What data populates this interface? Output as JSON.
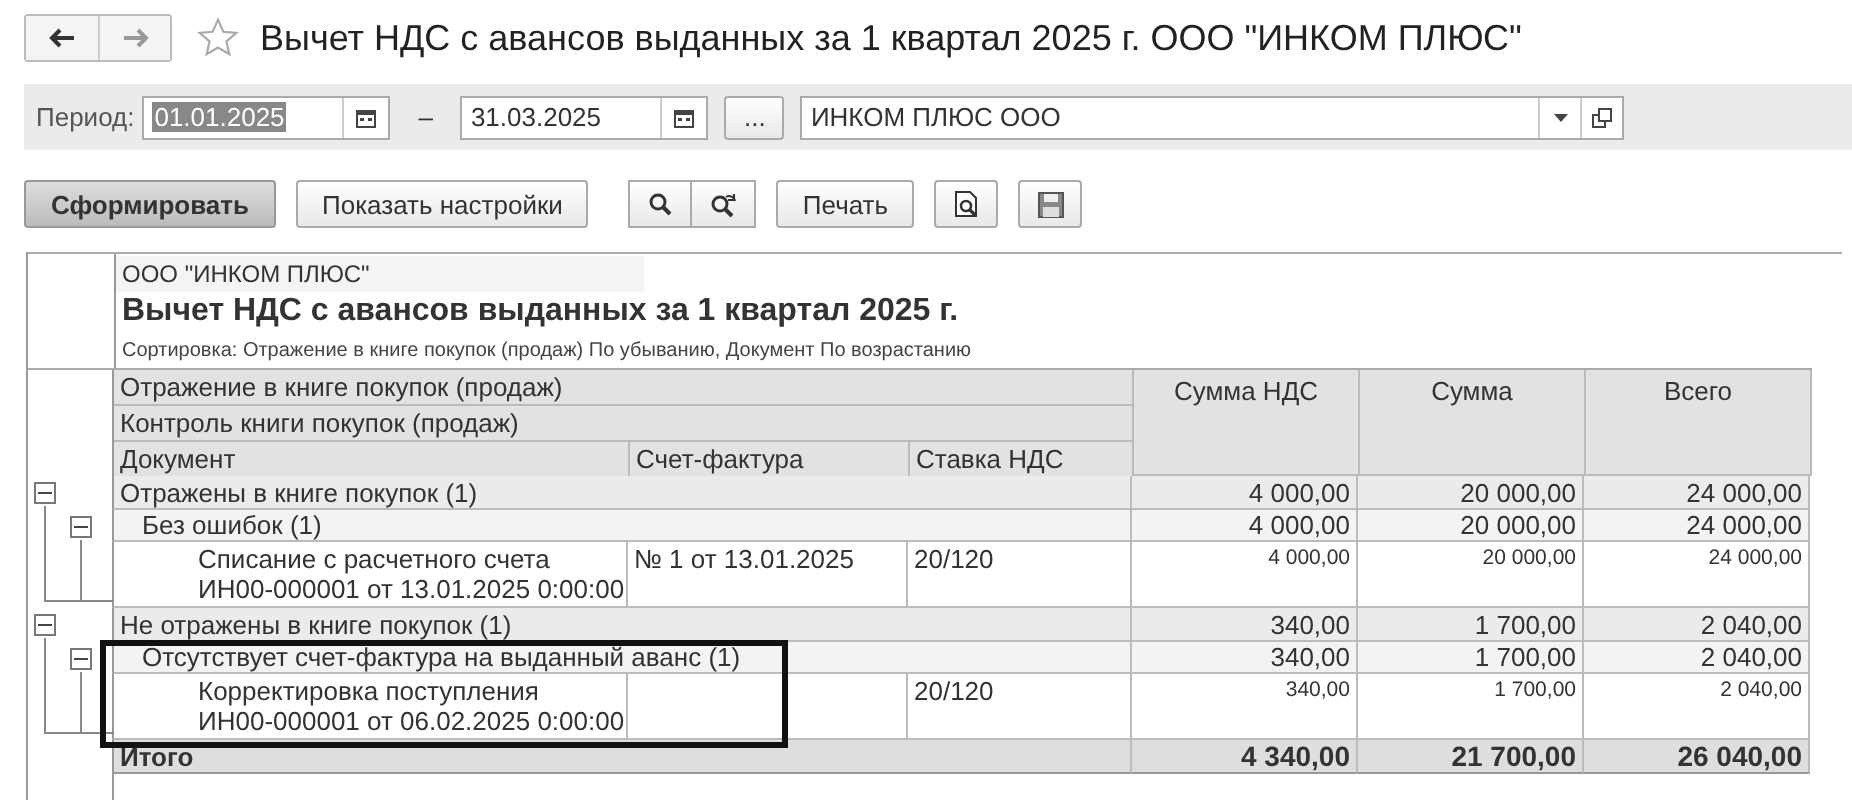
{
  "window": {
    "title": "Вычет НДС с авансов выданных за 1 квартал 2025 г. ООО \"ИНКОМ ПЛЮС\"",
    "favorite": false
  },
  "filter": {
    "period_label": "Период:",
    "date_from": "01.01.2025",
    "dash": "–",
    "date_to": "31.03.2025",
    "more": "...",
    "organization": "ИНКОМ ПЛЮС ООО"
  },
  "toolbar": {
    "generate": "Сформировать",
    "settings": "Показать настройки",
    "print": "Печать"
  },
  "report": {
    "organization": "ООО \"ИНКОМ ПЛЮС\"",
    "title": "Вычет НДС с авансов выданных за 1 квартал 2025 г.",
    "sort_note": "Сортировка: Отражение в книге покупок (продаж) По убыванию, Документ По возрастанию",
    "header": {
      "level_1": "Отражение в книге покупок (продаж)",
      "level_2": "Контроль книги покупок (продаж)",
      "columns": [
        "Документ",
        "Счет-фактура",
        "Ставка НДС",
        "Сумма НДС",
        "Сумма",
        "Всего"
      ]
    },
    "groups": [
      {
        "label": "Отражены в книге покупок (1)",
        "expanded": true,
        "vat": "4 000,00",
        "sum": "20 000,00",
        "total": "24 000,00",
        "children": [
          {
            "label": "Без ошибок (1)",
            "expanded": true,
            "highlighted": false,
            "vat": "4 000,00",
            "sum": "20 000,00",
            "total": "24 000,00",
            "documents": [
              {
                "lines": [
                  "Списание с расчетного счета",
                  "ИН00-000001 от 13.01.2025 0:00:00"
                ],
                "invoice": "№ 1 от 13.01.2025",
                "rate": "20/120",
                "vat": "4 000,00",
                "sum": "20 000,00",
                "total": "24 000,00"
              }
            ]
          }
        ]
      },
      {
        "label": "Не отражены в книге покупок (1)",
        "expanded": true,
        "vat": "340,00",
        "sum": "1 700,00",
        "total": "2 040,00",
        "children": [
          {
            "label": "Отсутствует счет-фактура на выданный аванс (1)",
            "expanded": true,
            "highlighted": true,
            "vat": "340,00",
            "sum": "1 700,00",
            "total": "2 040,00",
            "documents": [
              {
                "lines": [
                  "Корректировка поступления",
                  "ИН00-000001 от 06.02.2025 0:00:00"
                ],
                "rate": "20/120",
                "vat": "340,00",
                "sum": "1 700,00",
                "total": "2 040,00"
              }
            ]
          }
        ]
      }
    ],
    "grand_total": {
      "label": "Итого",
      "vat": "4 340,00",
      "sum": "21 700,00",
      "total": "26 040,00"
    }
  }
}
